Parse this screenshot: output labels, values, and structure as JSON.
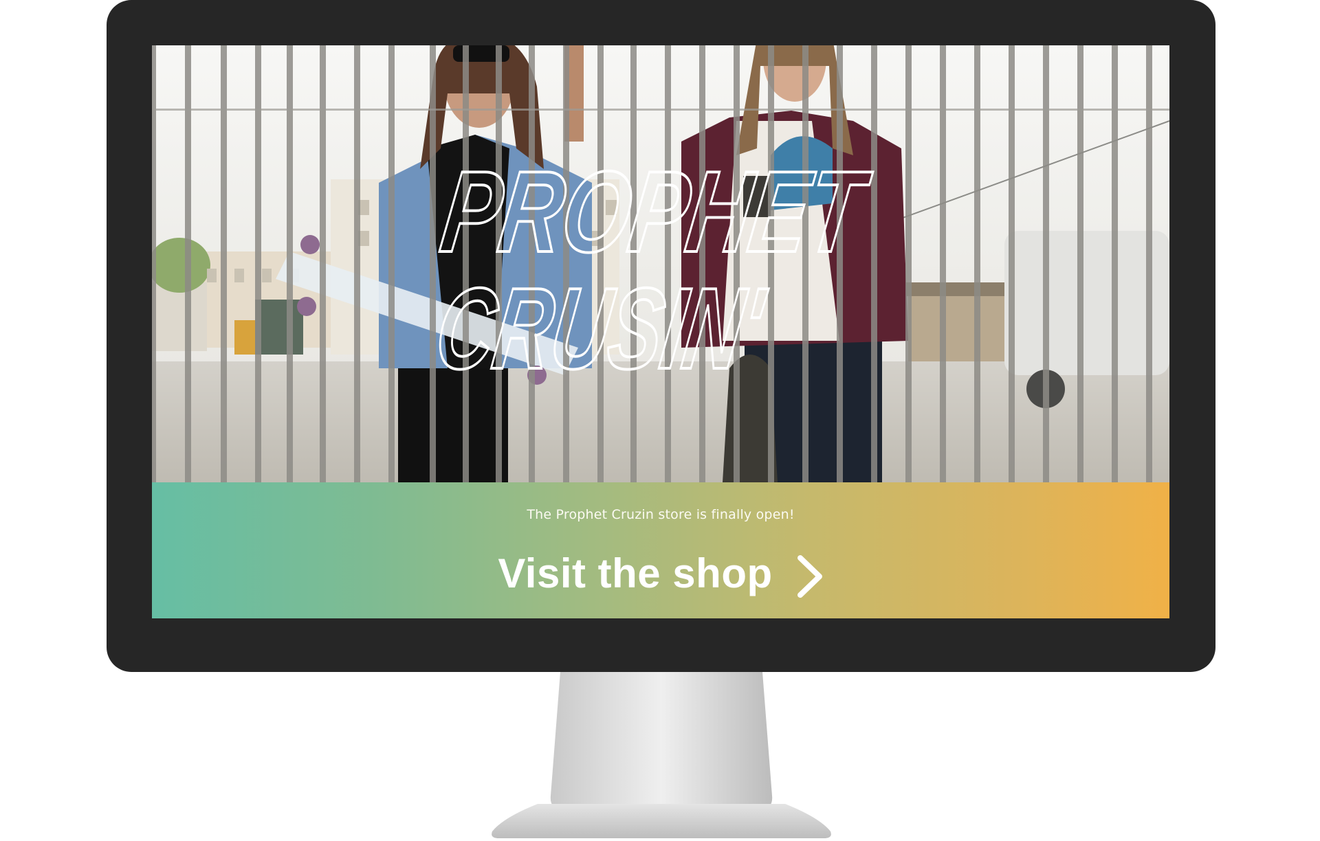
{
  "hero": {
    "logo_line1": "PROPHET",
    "logo_line2": "CRUSIN'"
  },
  "banner": {
    "subtitle": "The Prophet Cruzin store is finally open!",
    "cta_label": "Visit the shop",
    "gradient_start": "#66bea4",
    "gradient_end": "#f0b147"
  },
  "icons": {
    "cta_arrow": "chevron-right-icon"
  }
}
